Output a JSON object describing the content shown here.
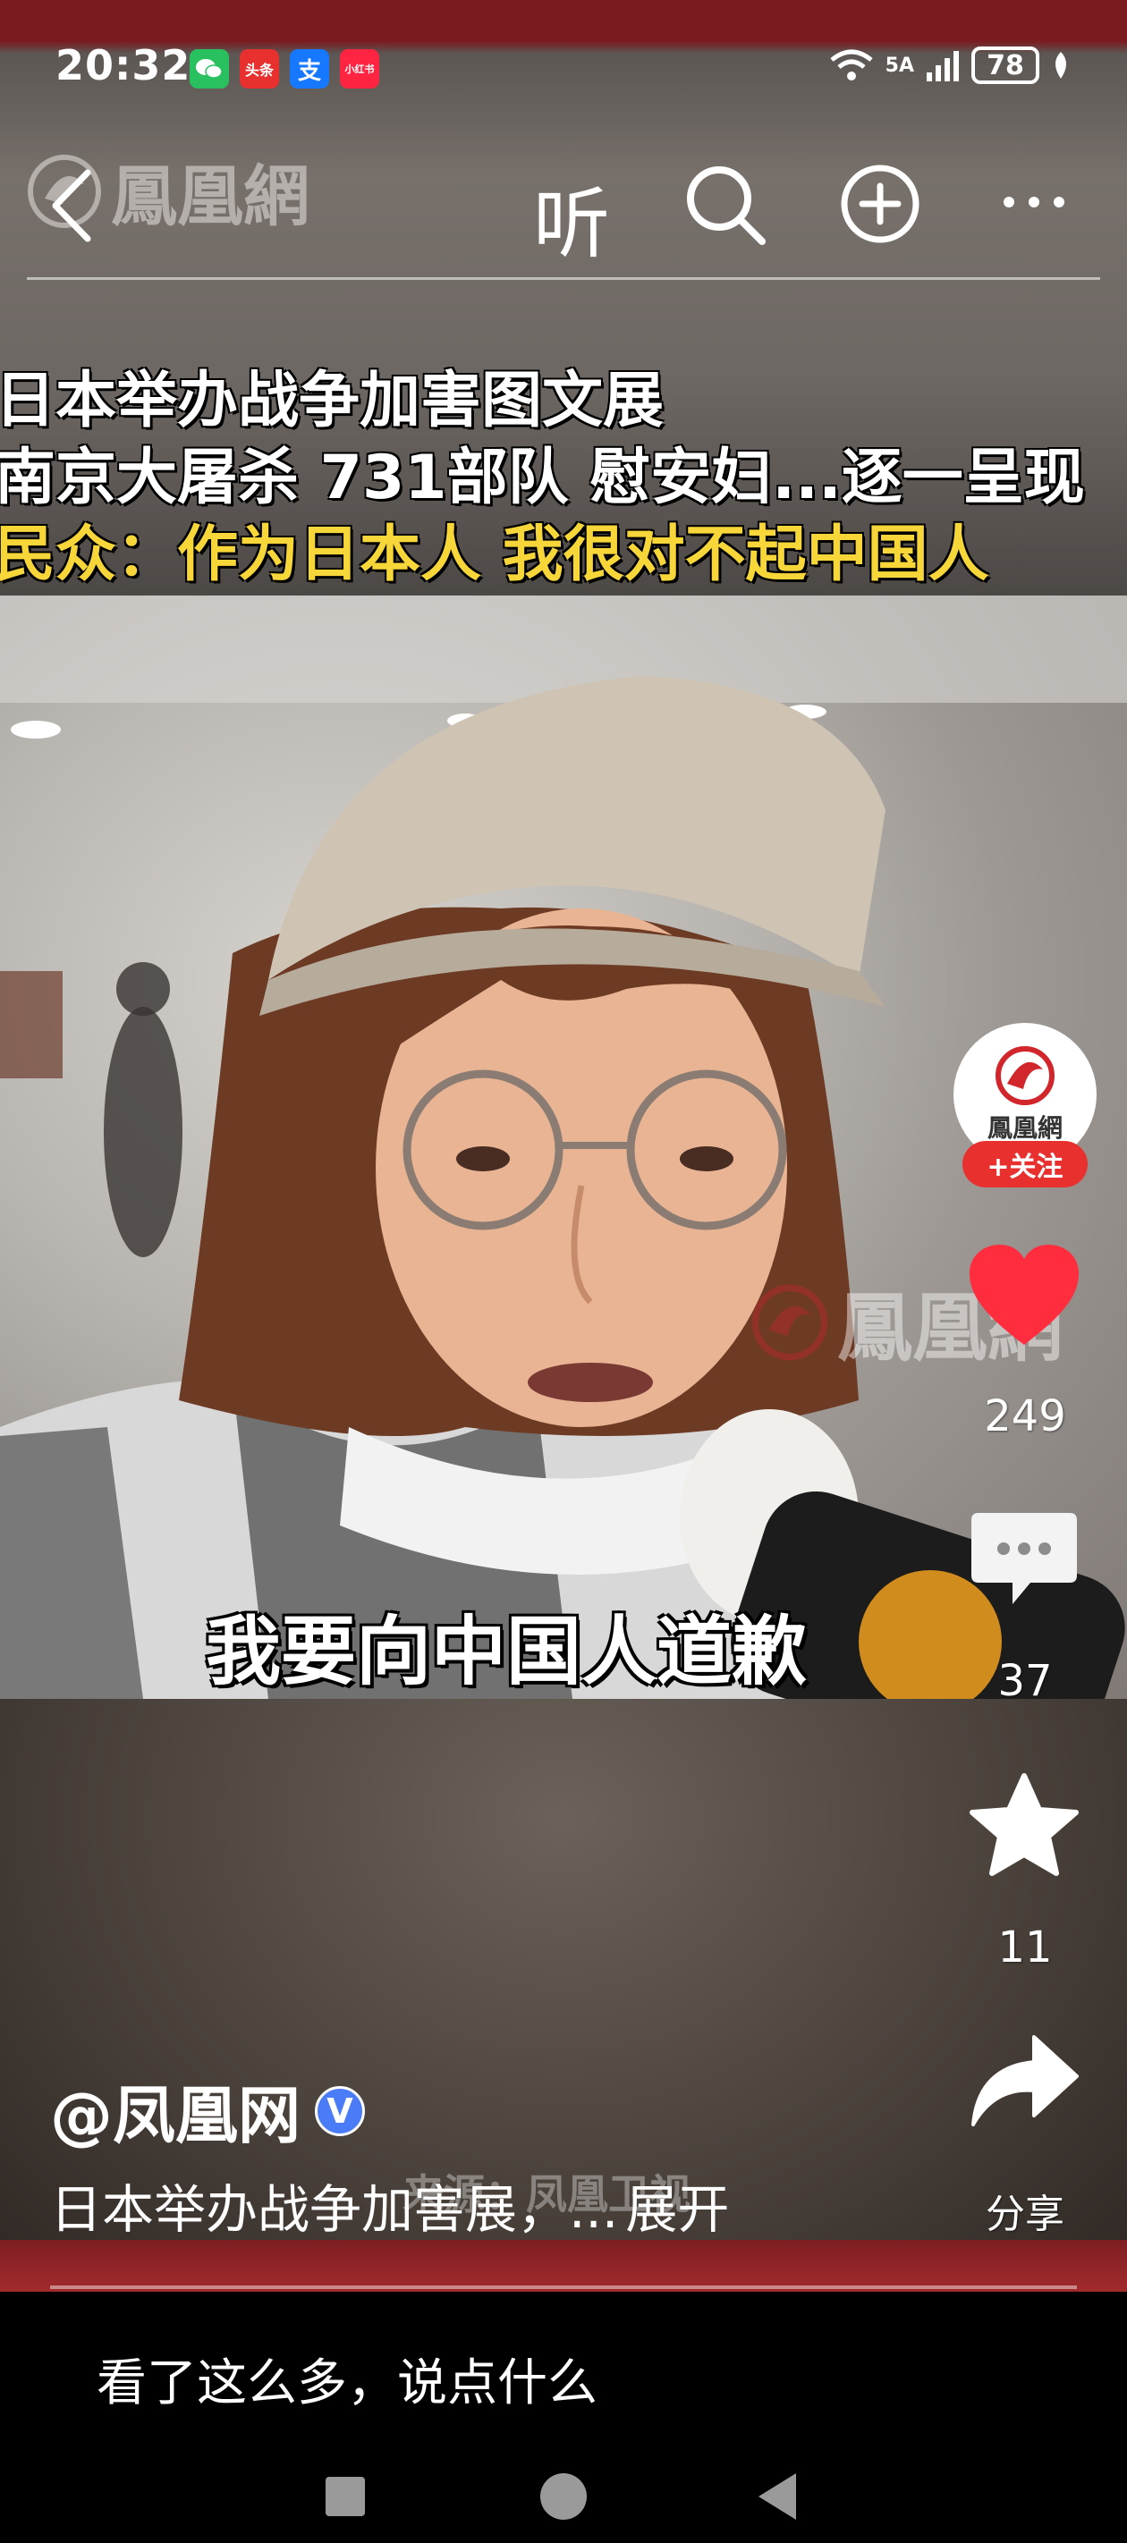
{
  "status_bar": {
    "time": "20:32",
    "apps": [
      {
        "name": "wechat-icon",
        "label": "",
        "color": "#29c15f"
      },
      {
        "name": "toutiao-icon",
        "label": "头条",
        "color": "#e8302f"
      },
      {
        "name": "alipay-icon",
        "label": "支",
        "color": "#1677ff"
      },
      {
        "name": "xiaohongshu-icon",
        "label": "小红书",
        "color": "#ff2442"
      }
    ],
    "network": "5A",
    "battery": "78"
  },
  "nav": {
    "watermark": "鳳凰網",
    "listen_label": "听"
  },
  "video": {
    "headline_1": "日本举办战争加害图文展",
    "headline_2": "南京大屠杀  731部队  慰安妇...逐一呈现",
    "headline_3": "民众：作为日本人  我很对不起中国人",
    "subtitle": "我要向中国人道歉",
    "frame_watermark": "鳳凰網",
    "source_watermark": "来源：凤凰卫视"
  },
  "actions": {
    "avatar_name": "鳳凰網",
    "follow_label": "+关注",
    "likes": "249",
    "comments": "37",
    "favorites": "11",
    "share_label": "分享",
    "like_color": "#ff2d3d"
  },
  "post": {
    "author": "@凤凰网",
    "verified_mark": "V",
    "description": "日本举办战争加害展，...",
    "expand_label": "展开"
  },
  "comment": {
    "placeholder": "看了这么多，说点什么"
  }
}
